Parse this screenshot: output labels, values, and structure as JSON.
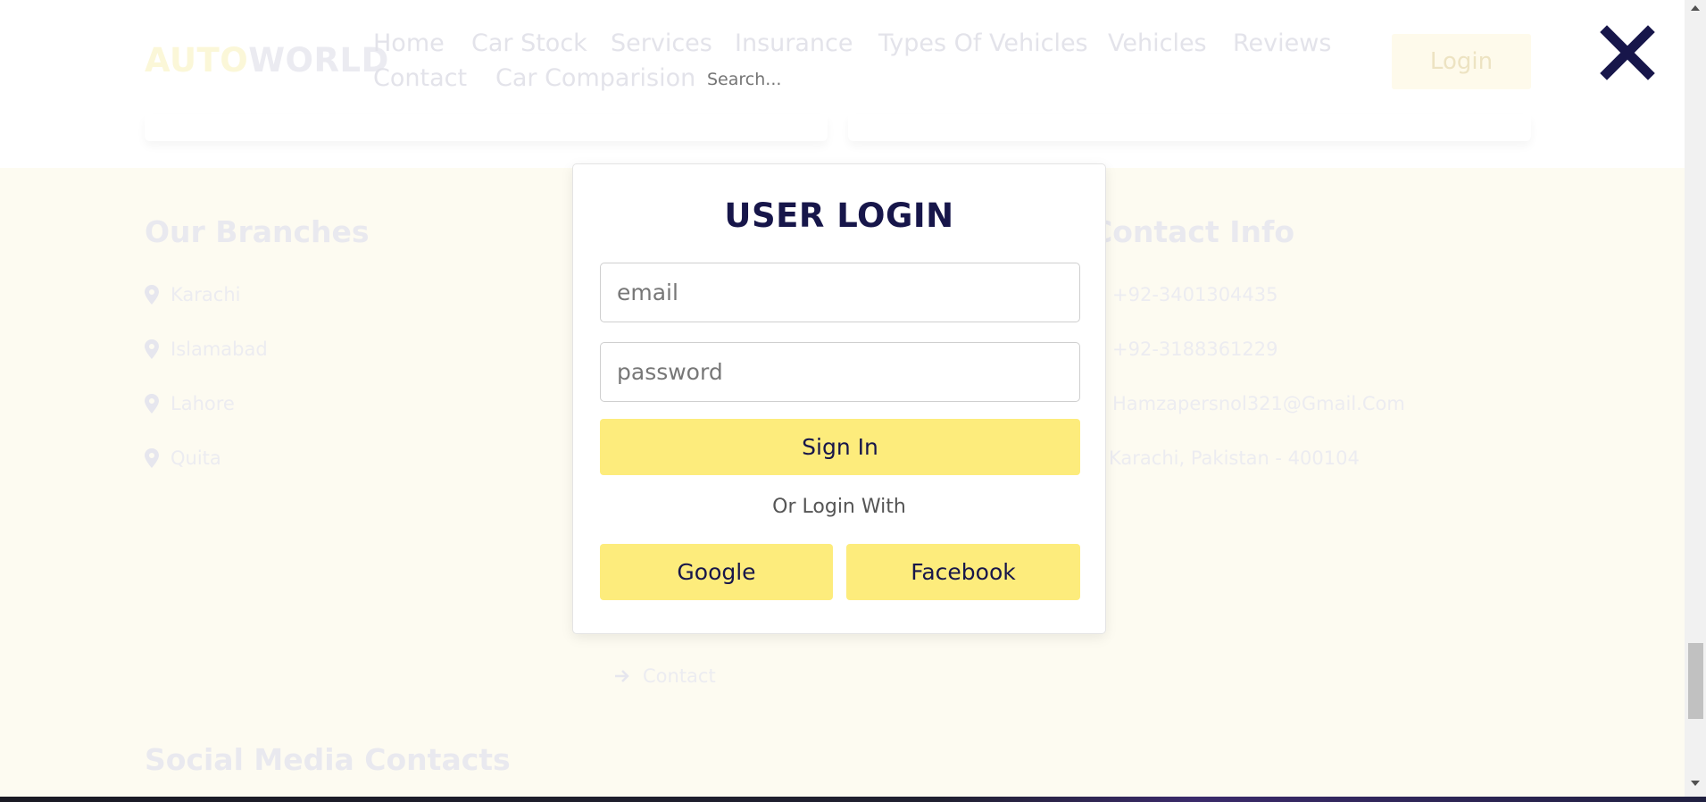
{
  "header": {
    "logo_part1": "AUTO",
    "logo_part2": "WORLD",
    "nav": [
      "Home",
      "Car Stock",
      "Services",
      "Insurance",
      "Types Of Vehicles",
      "Vehicles",
      "Reviews",
      "Contact",
      "Car Comparision"
    ],
    "search_placeholder": "Search...",
    "login_label": "Login",
    "close_icon": "close-x-icon"
  },
  "footer": {
    "branches_title": "Our Branches",
    "branches": [
      "Karachi",
      "Islamabad",
      "Lahore",
      "Quita"
    ],
    "contact_title": "Contact Info",
    "contact_lines": [
      "+92-3401304435",
      "+92-3188361229",
      "Hamzapersnol321@Gmail.Com",
      "Karachi, Pakistan - 400104"
    ],
    "link_visible": "Contact",
    "social_title": "Social Media Contacts"
  },
  "modal": {
    "title": "USER LOGIN",
    "email_placeholder": "email",
    "password_placeholder": "password",
    "sign_in_label": "Sign In",
    "or_text": "Or Login With",
    "google_label": "Google",
    "facebook_label": "Facebook"
  },
  "colors": {
    "accent_yellow": "#fdec7c",
    "title_navy": "#17164a",
    "page_bg": "#fdfbf1"
  }
}
